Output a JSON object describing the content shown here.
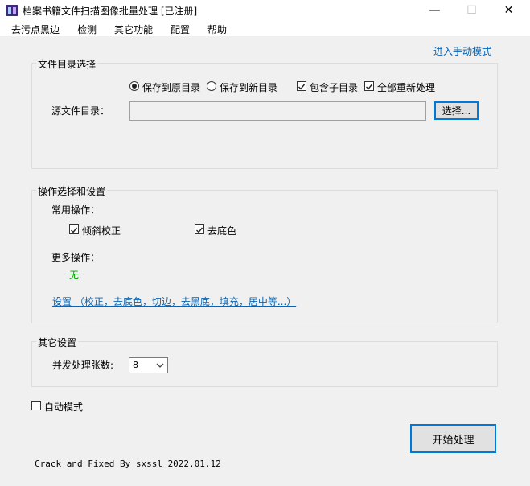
{
  "window": {
    "title": "档案书籍文件扫描图像批量处理 [已注册]",
    "minimize_glyph": "—",
    "maximize_glyph": "☐",
    "close_glyph": "✕"
  },
  "menu": [
    "去污点黑边",
    "检测",
    "其它功能",
    "配置",
    "帮助"
  ],
  "manual_mode_link": "进入手动模式",
  "file_dir": {
    "legend": "文件目录选择",
    "radio_original": "保存到原目录",
    "radio_new": "保存到新目录",
    "check_subdirs": "包含子目录",
    "check_reprocess": "全部重新处理",
    "source_label": "源文件目录：",
    "source_value": "",
    "choose_button": "选择..."
  },
  "ops": {
    "legend": "操作选择和设置",
    "common_label": "常用操作：",
    "check_deskew": "倾斜校正",
    "check_remove_bg": "去底色",
    "more_label": "更多操作：",
    "more_value": "无",
    "settings_link": "设置 （校正，去底色，切边，去黑底，填充，居中等...）"
  },
  "other": {
    "legend": "其它设置",
    "concurrency_label": "并发处理张数:",
    "concurrency_value": "8"
  },
  "auto_mode_label": "自动模式",
  "start_button": "开始处理",
  "footer_text": "Crack and Fixed By sxssl  2022.01.12",
  "colors": {
    "link": "#0b64b0",
    "accent_focus": "#0078d7",
    "none_value": "#00a000"
  }
}
